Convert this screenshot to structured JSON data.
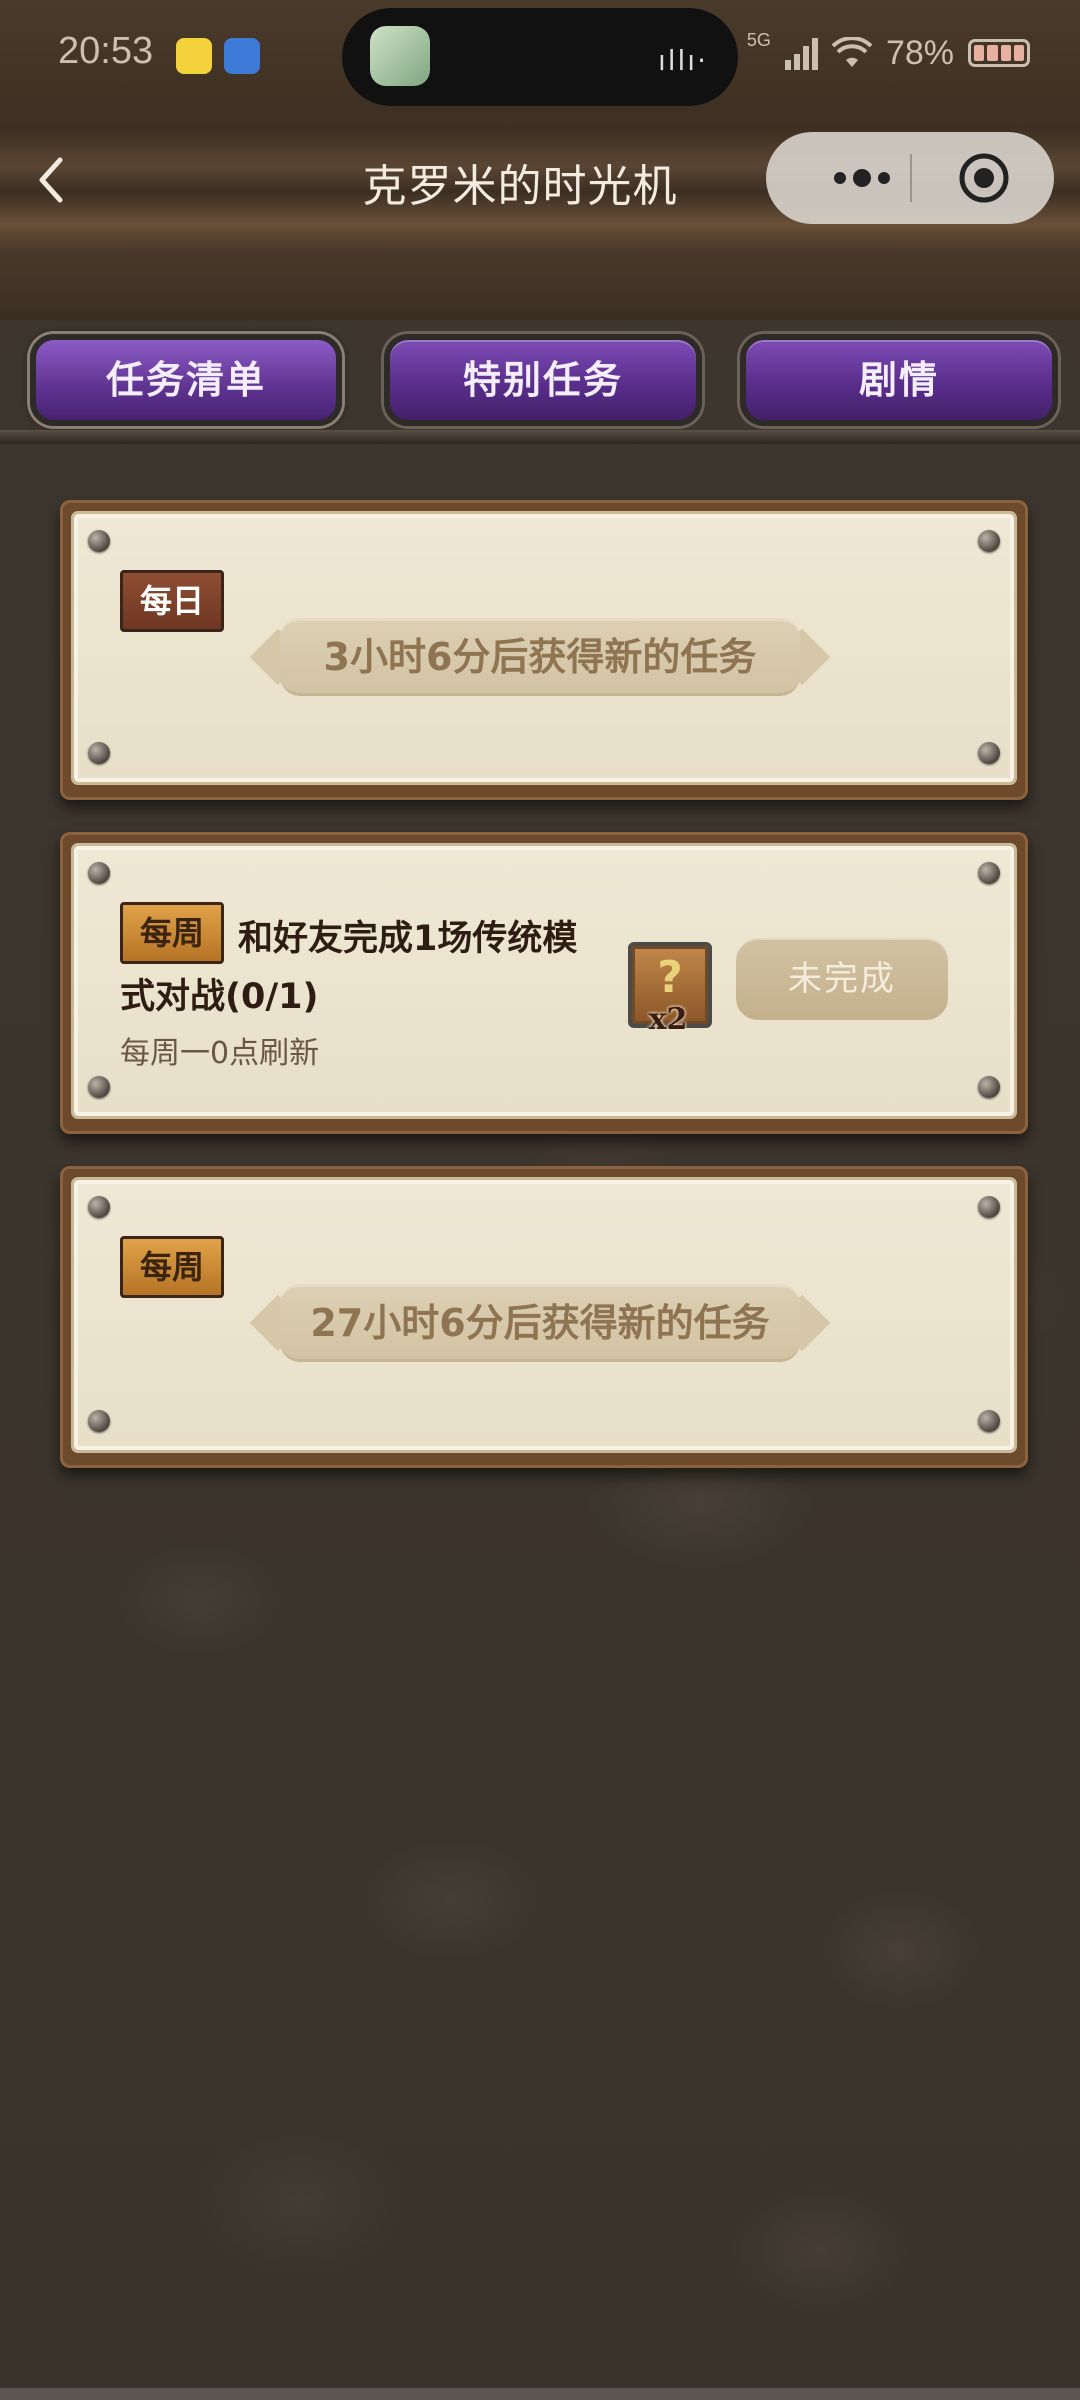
{
  "status_bar": {
    "time": "20:53",
    "network": "5G",
    "battery": "78%"
  },
  "nav": {
    "title": "克罗米的时光机"
  },
  "tabs": [
    {
      "label": "任务清单",
      "active": true
    },
    {
      "label": "特别任务",
      "active": false
    },
    {
      "label": "剧情",
      "active": false
    }
  ],
  "cards": {
    "daily": {
      "tag": "每日",
      "banner": "3小时6分后获得新的任务"
    },
    "weekly_task": {
      "tag": "每周",
      "title": "和好友完成1场传统模式对战(0/1)",
      "refresh": "每周一0点刷新",
      "reward_qty": "x2",
      "status": "未完成"
    },
    "weekly": {
      "tag": "每周",
      "banner": "27小时6分后获得新的任务"
    }
  },
  "colors": {
    "tab_purple": "#5a2e8c",
    "card_parchment": "#efe8d4",
    "banner_text": "#8f7452",
    "weekly_tag": "#e1a24a",
    "daily_tag": "#8f4e33"
  }
}
